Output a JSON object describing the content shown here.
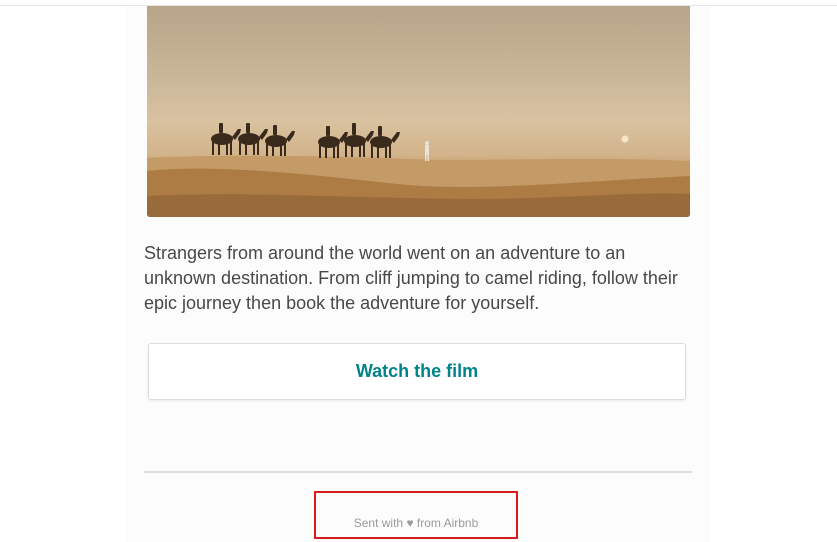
{
  "hero": {
    "image_alt": "Camel caravan crossing desert dunes at sunset"
  },
  "body": {
    "paragraph": "Strangers from around the world went on an adventure to an unknown destination. From cliff jumping to camel riding, follow their epic journey then book the adventure for yourself."
  },
  "cta": {
    "label": "Watch the film"
  },
  "footer": {
    "prefix": "Sent with",
    "heart_icon": "heart-icon",
    "suffix": "from Airbnb"
  },
  "colors": {
    "accent": "#00848a",
    "highlight_box": "#d41c1c",
    "text": "#484848",
    "muted": "#9b9b9b"
  }
}
